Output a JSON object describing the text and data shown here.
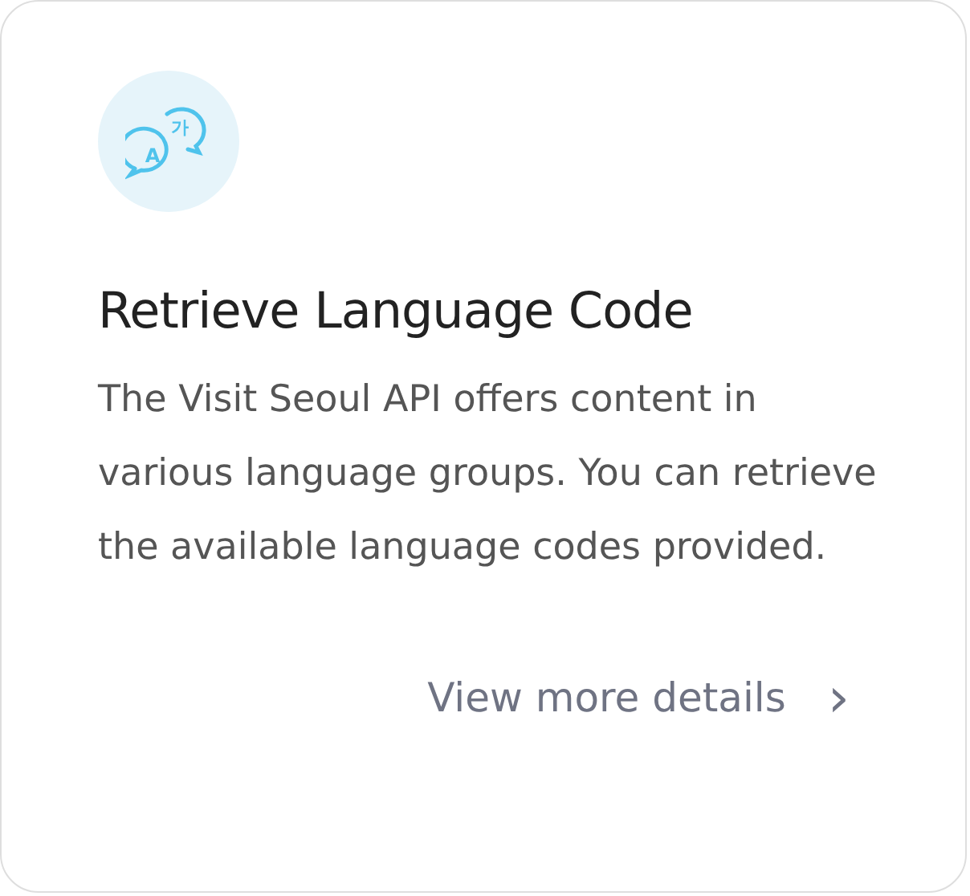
{
  "card": {
    "icon": {
      "letters": [
        "가",
        "A"
      ]
    },
    "title": "Retrieve Language Code",
    "description": "The Visit Seoul API offers content in various language groups. You can retrieve the available language codes provided.",
    "link": {
      "label": "View more details",
      "chevron": "›"
    }
  }
}
